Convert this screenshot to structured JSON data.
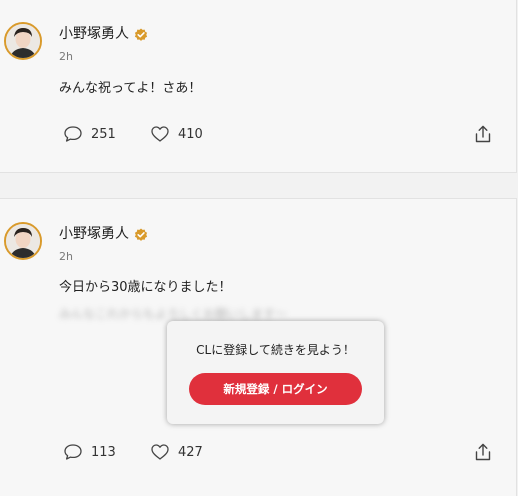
{
  "posts": [
    {
      "author": "小野塚勇人",
      "time": "2h",
      "text": "みんな祝ってよ！さあ！",
      "comments": "251",
      "likes": "410"
    },
    {
      "author": "小野塚勇人",
      "time": "2h",
      "text": "今日から30歳になりました！",
      "hidden_text": "みんなこれからもよろしくお願いします〜",
      "comments": "113",
      "likes": "427"
    }
  ],
  "overlay": {
    "message": "CLに登録して続きを見よう！",
    "button_label": "新規登録 / ログイン"
  },
  "colors": {
    "verified_badge": "#d99a2b",
    "avatar_ring": "#d99a2b",
    "login_button": "#e0303c"
  },
  "icons": [
    "verified-badge-icon",
    "comment-icon",
    "heart-icon",
    "share-icon"
  ]
}
